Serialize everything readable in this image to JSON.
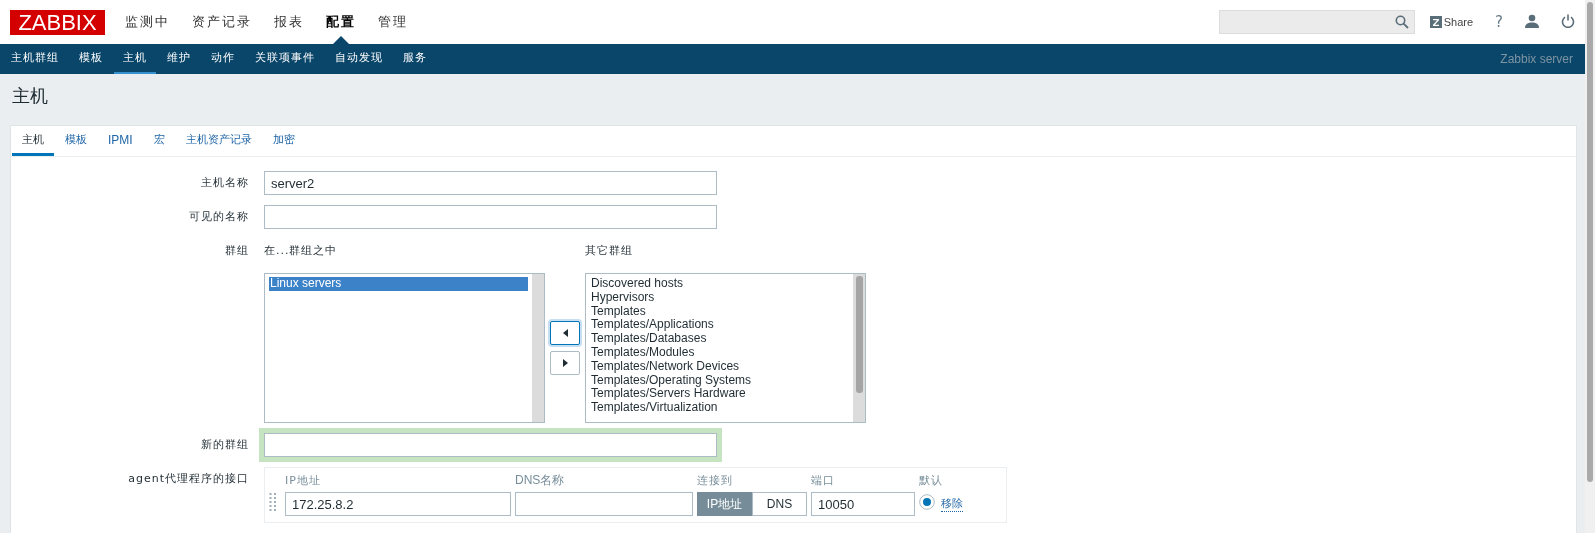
{
  "header": {
    "logo": "ZABBIX",
    "menu": [
      {
        "label": "监测中",
        "selected": false
      },
      {
        "label": "资产记录",
        "selected": false
      },
      {
        "label": "报表",
        "selected": false
      },
      {
        "label": "配置",
        "selected": true
      },
      {
        "label": "管理",
        "selected": false
      }
    ],
    "share": "Share",
    "help": "?"
  },
  "subnav": {
    "items": [
      {
        "label": "主机群组",
        "selected": false
      },
      {
        "label": "模板",
        "selected": false
      },
      {
        "label": "主机",
        "selected": true
      },
      {
        "label": "维护",
        "selected": false
      },
      {
        "label": "动作",
        "selected": false
      },
      {
        "label": "关联项事件",
        "selected": false
      },
      {
        "label": "自动发现",
        "selected": false
      },
      {
        "label": "服务",
        "selected": false
      }
    ],
    "server": "Zabbix server"
  },
  "page_title": "主机",
  "tabs": [
    {
      "label": "主机",
      "selected": true
    },
    {
      "label": "模板",
      "selected": false
    },
    {
      "label": "IPMI",
      "selected": false
    },
    {
      "label": "宏",
      "selected": false
    },
    {
      "label": "主机资产记录",
      "selected": false
    },
    {
      "label": "加密",
      "selected": false
    }
  ],
  "form": {
    "host_name": {
      "label": "主机名称",
      "value": "server2"
    },
    "visible_name": {
      "label": "可见的名称"
    },
    "groups": {
      "label": "群组",
      "in_label": "在...群组之中",
      "other_label": "其它群组",
      "in_groups": [
        {
          "label": "Linux servers",
          "selected": true
        }
      ],
      "move_buttons": [
        {
          "kind": "left",
          "focused": true
        },
        {
          "kind": "right",
          "focused": false
        }
      ],
      "other_groups": [
        {
          "label": "Discovered hosts",
          "selected": false
        },
        {
          "label": "Hypervisors",
          "selected": false
        },
        {
          "label": "Templates",
          "selected": false
        },
        {
          "label": "Templates/Applications",
          "selected": false
        },
        {
          "label": "Templates/Databases",
          "selected": false
        },
        {
          "label": "Templates/Modules",
          "selected": false
        },
        {
          "label": "Templates/Network Devices",
          "selected": false
        },
        {
          "label": "Templates/Operating Systems",
          "selected": false
        },
        {
          "label": "Templates/Servers Hardware",
          "selected": false
        },
        {
          "label": "Templates/Virtualization",
          "selected": false
        }
      ]
    },
    "new_group": {
      "label": "新的群组",
      "focused": true
    },
    "agent": {
      "label": "agent代理程序的接口",
      "columns": [
        "IP地址",
        "DNS名称",
        "连接到",
        "端口",
        "默认"
      ],
      "rows": [
        {
          "ip": "172.25.8.2",
          "connect": [
            {
              "label": "IP地址",
              "selected": true
            },
            {
              "label": "DNS",
              "selected": false
            }
          ],
          "port": "10050",
          "default": true,
          "remove": "移除"
        }
      ]
    }
  }
}
